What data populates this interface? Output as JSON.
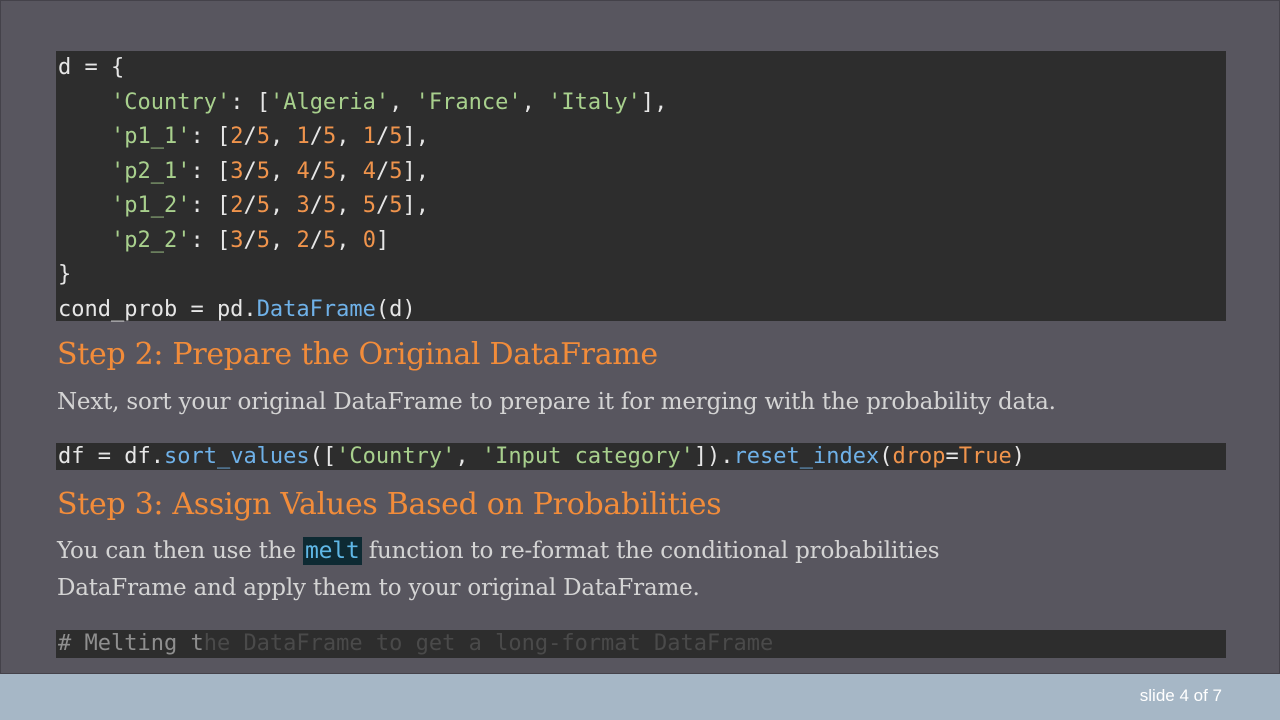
{
  "code_block_1": {
    "lines": [
      [
        {
          "t": "d = {",
          "c": ""
        }
      ],
      [
        {
          "t": "    ",
          "c": ""
        },
        {
          "t": "'Country'",
          "c": "str"
        },
        {
          "t": ": [",
          "c": ""
        },
        {
          "t": "'Algeria'",
          "c": "str"
        },
        {
          "t": ", ",
          "c": ""
        },
        {
          "t": "'France'",
          "c": "str"
        },
        {
          "t": ", ",
          "c": ""
        },
        {
          "t": "'Italy'",
          "c": "str"
        },
        {
          "t": "],",
          "c": ""
        }
      ],
      [
        {
          "t": "    ",
          "c": ""
        },
        {
          "t": "'p1_1'",
          "c": "str"
        },
        {
          "t": ": [",
          "c": ""
        },
        {
          "t": "2",
          "c": "num"
        },
        {
          "t": "/",
          "c": ""
        },
        {
          "t": "5",
          "c": "num"
        },
        {
          "t": ", ",
          "c": ""
        },
        {
          "t": "1",
          "c": "num"
        },
        {
          "t": "/",
          "c": ""
        },
        {
          "t": "5",
          "c": "num"
        },
        {
          "t": ", ",
          "c": ""
        },
        {
          "t": "1",
          "c": "num"
        },
        {
          "t": "/",
          "c": ""
        },
        {
          "t": "5",
          "c": "num"
        },
        {
          "t": "],",
          "c": ""
        }
      ],
      [
        {
          "t": "    ",
          "c": ""
        },
        {
          "t": "'p2_1'",
          "c": "str"
        },
        {
          "t": ": [",
          "c": ""
        },
        {
          "t": "3",
          "c": "num"
        },
        {
          "t": "/",
          "c": ""
        },
        {
          "t": "5",
          "c": "num"
        },
        {
          "t": ", ",
          "c": ""
        },
        {
          "t": "4",
          "c": "num"
        },
        {
          "t": "/",
          "c": ""
        },
        {
          "t": "5",
          "c": "num"
        },
        {
          "t": ", ",
          "c": ""
        },
        {
          "t": "4",
          "c": "num"
        },
        {
          "t": "/",
          "c": ""
        },
        {
          "t": "5",
          "c": "num"
        },
        {
          "t": "],",
          "c": ""
        }
      ],
      [
        {
          "t": "    ",
          "c": ""
        },
        {
          "t": "'p1_2'",
          "c": "str"
        },
        {
          "t": ": [",
          "c": ""
        },
        {
          "t": "2",
          "c": "num"
        },
        {
          "t": "/",
          "c": ""
        },
        {
          "t": "5",
          "c": "num"
        },
        {
          "t": ", ",
          "c": ""
        },
        {
          "t": "3",
          "c": "num"
        },
        {
          "t": "/",
          "c": ""
        },
        {
          "t": "5",
          "c": "num"
        },
        {
          "t": ", ",
          "c": ""
        },
        {
          "t": "5",
          "c": "num"
        },
        {
          "t": "/",
          "c": ""
        },
        {
          "t": "5",
          "c": "num"
        },
        {
          "t": "],",
          "c": ""
        }
      ],
      [
        {
          "t": "    ",
          "c": ""
        },
        {
          "t": "'p2_2'",
          "c": "str"
        },
        {
          "t": ": [",
          "c": ""
        },
        {
          "t": "3",
          "c": "num"
        },
        {
          "t": "/",
          "c": ""
        },
        {
          "t": "5",
          "c": "num"
        },
        {
          "t": ", ",
          "c": ""
        },
        {
          "t": "2",
          "c": "num"
        },
        {
          "t": "/",
          "c": ""
        },
        {
          "t": "5",
          "c": "num"
        },
        {
          "t": ", ",
          "c": ""
        },
        {
          "t": "0",
          "c": "num"
        },
        {
          "t": "]",
          "c": ""
        }
      ],
      [
        {
          "t": "}",
          "c": ""
        }
      ],
      [
        {
          "t": "cond_prob = pd.",
          "c": ""
        },
        {
          "t": "DataFrame",
          "c": "fn"
        },
        {
          "t": "(d)",
          "c": ""
        }
      ]
    ]
  },
  "step2": {
    "heading": "Step 2: Prepare the Original DataFrame",
    "text": "Next, sort your original DataFrame to prepare it for merging with the probability data."
  },
  "code_block_2": {
    "lines": [
      [
        {
          "t": "df = df.",
          "c": ""
        },
        {
          "t": "sort_values",
          "c": "fn"
        },
        {
          "t": "([",
          "c": ""
        },
        {
          "t": "'Country'",
          "c": "str"
        },
        {
          "t": ", ",
          "c": ""
        },
        {
          "t": "'Input category'",
          "c": "str"
        },
        {
          "t": "]).",
          "c": ""
        },
        {
          "t": "reset_index",
          "c": "fn"
        },
        {
          "t": "(",
          "c": ""
        },
        {
          "t": "drop",
          "c": "kw"
        },
        {
          "t": "=",
          "c": ""
        },
        {
          "t": "True",
          "c": "kw"
        },
        {
          "t": ")",
          "c": ""
        }
      ]
    ]
  },
  "step3": {
    "heading": "Step 3: Assign Values Based on Probabilities",
    "text_before": "You can then use the ",
    "inline_code": "melt",
    "text_after": " function to re-format the conditional probabilities",
    "text_line2": "DataFrame and apply them to your original DataFrame."
  },
  "code_block_3": {
    "lines": [
      [
        {
          "t": "# Melting t",
          "c": "com"
        },
        {
          "t": "he DataFrame to get a long-format DataFrame",
          "c": "fade"
        }
      ]
    ]
  },
  "footer": {
    "slide_indicator": "slide 4 of 7"
  },
  "colors": {
    "background": "#58565f",
    "code_background": "#2d2d2d",
    "heading": "#f28c3a",
    "footer": "#a6b7c6"
  }
}
